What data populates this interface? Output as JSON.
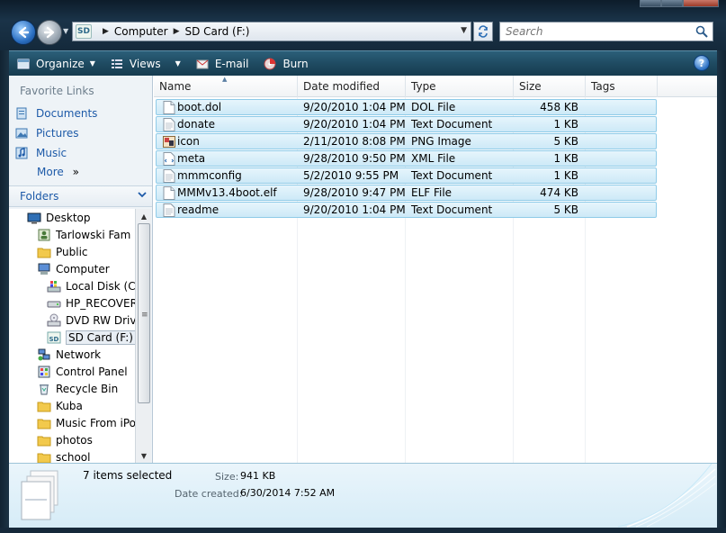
{
  "address": {
    "crumbs": [
      "Computer",
      "SD Card (F:)"
    ],
    "drive_icon_text": "SD"
  },
  "search": {
    "placeholder": "Search"
  },
  "toolbar": {
    "organize": "Organize",
    "views": "Views",
    "email": "E-mail",
    "burn": "Burn",
    "help": "?"
  },
  "nav": {
    "favorites_header": "Favorite Links",
    "favorites": [
      "Documents",
      "Pictures",
      "Music"
    ],
    "more": "More",
    "folders_label": "Folders",
    "tree": [
      {
        "label": "Desktop",
        "icon": "desktop-icon",
        "indent": 0
      },
      {
        "label": "Tarlowski Fam",
        "icon": "user-folder-icon",
        "indent": 1
      },
      {
        "label": "Public",
        "icon": "folder-icon",
        "indent": 1
      },
      {
        "label": "Computer",
        "icon": "computer-icon",
        "indent": 1
      },
      {
        "label": "Local Disk (C:)",
        "icon": "windows-drive-icon",
        "indent": 2
      },
      {
        "label": "HP_RECOVERY",
        "icon": "drive-icon",
        "indent": 2
      },
      {
        "label": "DVD RW Drive",
        "icon": "dvd-drive-icon",
        "indent": 2
      },
      {
        "label": "SD Card (F:)",
        "icon": "sd-card-icon",
        "indent": 2,
        "selected": true
      },
      {
        "label": "Network",
        "icon": "network-icon",
        "indent": 1
      },
      {
        "label": "Control Panel",
        "icon": "control-panel-icon",
        "indent": 1
      },
      {
        "label": "Recycle Bin",
        "icon": "recycle-bin-icon",
        "indent": 1
      },
      {
        "label": "Kuba",
        "icon": "folder-icon",
        "indent": 1
      },
      {
        "label": "Music From iPod",
        "icon": "folder-icon",
        "indent": 1
      },
      {
        "label": "photos",
        "icon": "folder-icon",
        "indent": 1
      },
      {
        "label": "school",
        "icon": "folder-icon",
        "indent": 1
      }
    ]
  },
  "columns": [
    "Name",
    "Date modified",
    "Type",
    "Size",
    "Tags"
  ],
  "files": [
    {
      "name": "boot.dol",
      "date": "9/20/2010 1:04 PM",
      "type": "DOL File",
      "size": "458 KB",
      "icon": "file-icon"
    },
    {
      "name": "donate",
      "date": "9/20/2010 1:04 PM",
      "type": "Text Document",
      "size": "1 KB",
      "icon": "text-file-icon"
    },
    {
      "name": "icon",
      "date": "2/11/2010 8:08 PM",
      "type": "PNG Image",
      "size": "5 KB",
      "icon": "image-file-icon"
    },
    {
      "name": "meta",
      "date": "9/28/2010 9:50 PM",
      "type": "XML File",
      "size": "1 KB",
      "icon": "xml-file-icon"
    },
    {
      "name": "mmmconfig",
      "date": "5/2/2010 9:55 PM",
      "type": "Text Document",
      "size": "1 KB",
      "icon": "text-file-icon"
    },
    {
      "name": "MMMv13.4boot.elf",
      "date": "9/28/2010 9:47 PM",
      "type": "ELF File",
      "size": "474 KB",
      "icon": "file-icon"
    },
    {
      "name": "readme",
      "date": "9/20/2010 1:04 PM",
      "type": "Text Document",
      "size": "5 KB",
      "icon": "text-file-icon"
    }
  ],
  "details": {
    "selected_count": "7 items selected",
    "size_label": "Size:",
    "size_value": "941 KB",
    "date_label": "Date created:",
    "date_value": "6/30/2014 7:52 AM"
  }
}
